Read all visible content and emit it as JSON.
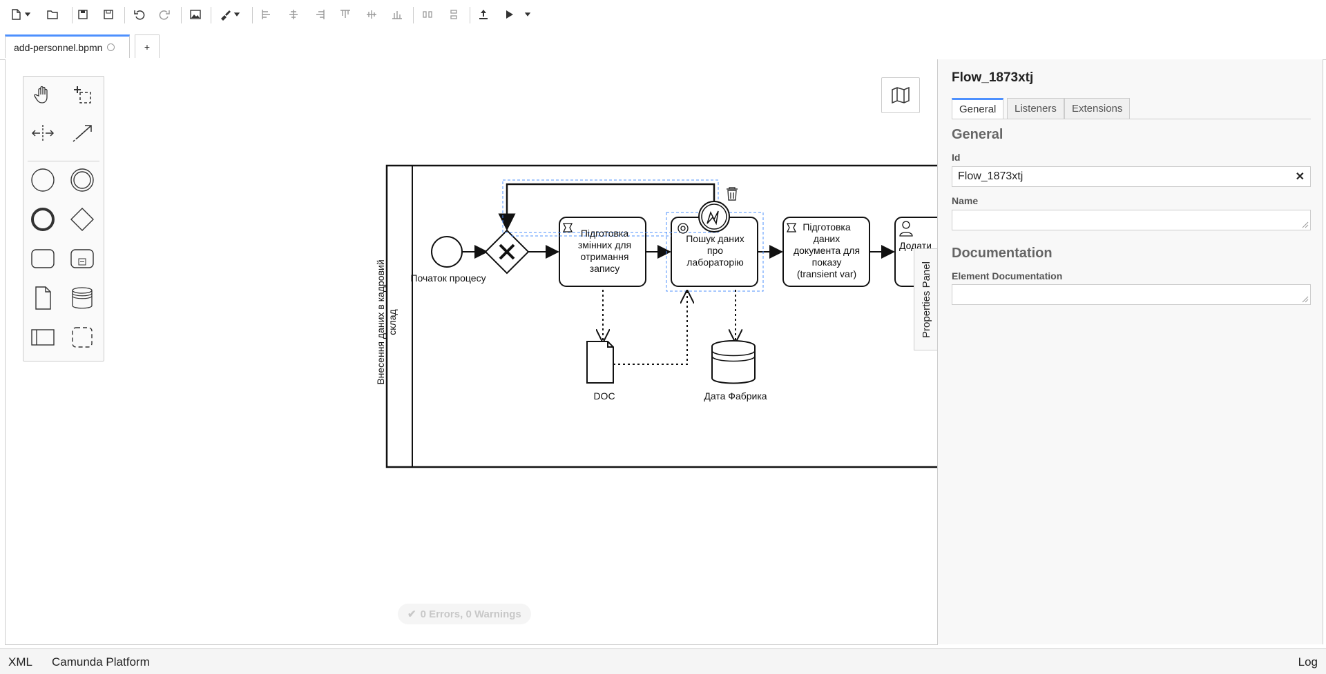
{
  "toolbar": {
    "items": [
      "new-file",
      "open-file",
      "save",
      "save-as",
      "undo",
      "redo",
      "export-image",
      "color-picker",
      "align-left",
      "align-center",
      "align-right",
      "align-top",
      "align-middle",
      "align-bottom",
      "distribute-horizontally",
      "distribute-vertically",
      "deploy",
      "start-instance"
    ]
  },
  "tabs": {
    "file_name": "add-personnel.bpmn",
    "add_label": "+"
  },
  "diagram": {
    "pool_label": "Внесення даних в кадровий склад",
    "start_label": "Початок процесу",
    "task1": [
      "Підготовка",
      "змінних для",
      "отримання",
      "запису"
    ],
    "task2": [
      "Пошук даних",
      "про",
      "лабораторію"
    ],
    "task3": [
      "Підготовка",
      "даних",
      "документа для",
      "показу",
      "(transient var)"
    ],
    "task4": "Додати",
    "doc_label": "DOC",
    "datastore_label": "Дата Фабрика"
  },
  "status": {
    "text": "0 Errors, 0 Warnings"
  },
  "properties": {
    "title": "Flow_1873xtj",
    "tabs": [
      "General",
      "Listeners",
      "Extensions"
    ],
    "general_heading": "General",
    "id_label": "Id",
    "id_value": "Flow_1873xtj",
    "name_label": "Name",
    "name_value": "",
    "doc_heading": "Documentation",
    "doc_label": "Element Documentation",
    "doc_value": "",
    "side_tab": "Properties Panel"
  },
  "footer": {
    "xml": "XML",
    "platform": "Camunda Platform",
    "log": "Log"
  }
}
